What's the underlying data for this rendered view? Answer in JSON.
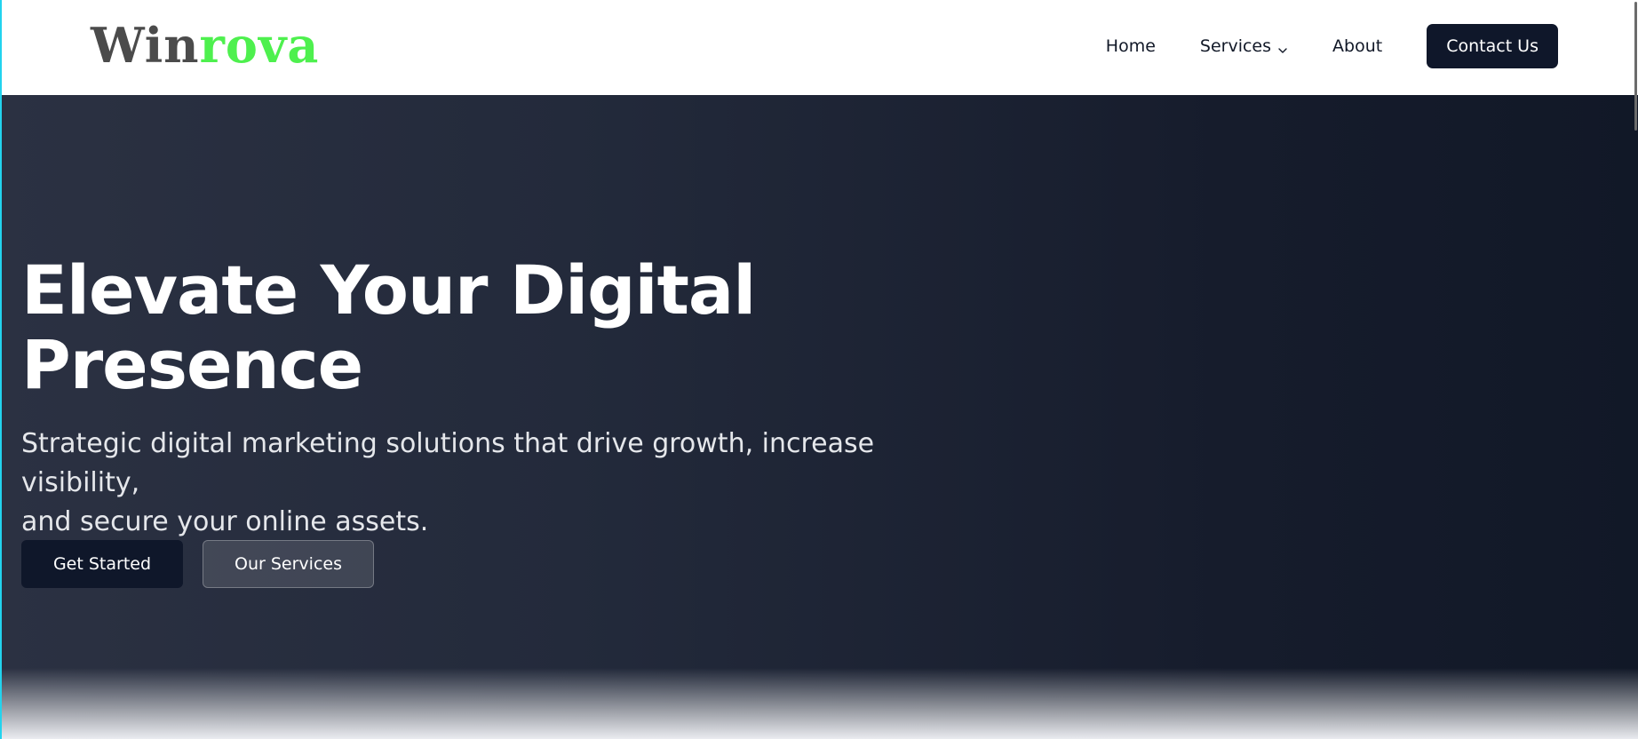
{
  "brand": {
    "part1": "Win",
    "part2": "rova",
    "color_part1": "#4b4b4b",
    "color_part2": "#4ef04e"
  },
  "nav": {
    "items": [
      {
        "label": "Home"
      },
      {
        "label": "Services",
        "icon": "chevron-down-icon"
      },
      {
        "label": "About"
      }
    ],
    "contact_label": "Contact Us"
  },
  "hero": {
    "title_line1": "Elevate Your Digital",
    "title_line2": "Presence",
    "subtitle_line1": "Strategic digital marketing solutions that drive growth, increase visibility,",
    "subtitle_line2": "and secure your online assets.",
    "primary_button": "Get Started",
    "secondary_button": "Our Services"
  },
  "colors": {
    "hero_bg": "#232a3b",
    "primary": "#0f172a",
    "accent": "#22d3ee"
  }
}
